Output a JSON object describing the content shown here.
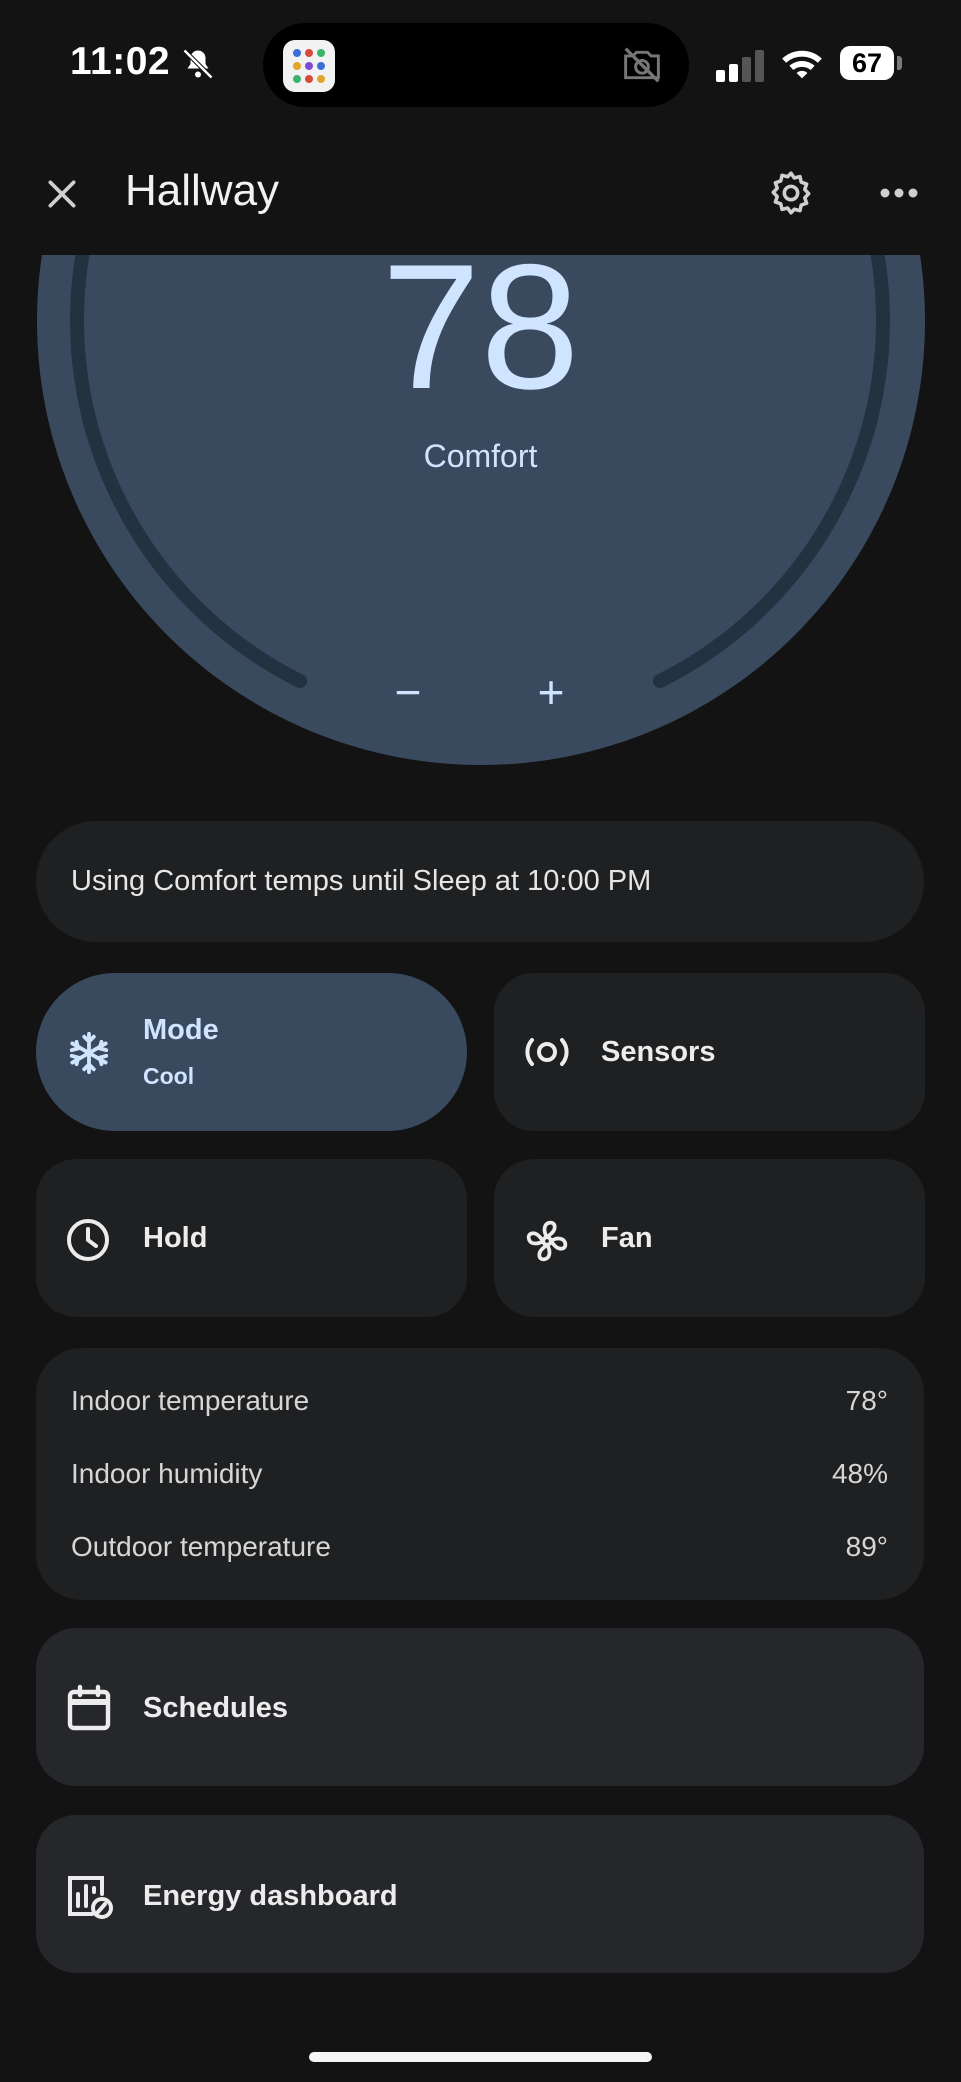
{
  "status_bar": {
    "time": "11:02",
    "battery": "67"
  },
  "header": {
    "title": "Hallway",
    "close_icon": "close-icon",
    "settings_icon": "gear-icon",
    "more_icon": "more-horizontal-icon"
  },
  "dial": {
    "temperature": "78",
    "preset": "Comfort",
    "decrease_label": "−",
    "increase_label": "+"
  },
  "banner": {
    "text": "Using Comfort temps until Sleep at 10:00 PM"
  },
  "tiles": {
    "mode": {
      "label": "Mode",
      "value": "Cool",
      "icon": "snowflake-icon"
    },
    "sensors": {
      "label": "Sensors",
      "icon": "sensor-icon"
    },
    "hold": {
      "label": "Hold",
      "icon": "clock-icon"
    },
    "fan": {
      "label": "Fan",
      "icon": "fan-icon"
    }
  },
  "stats": [
    {
      "label": "Indoor temperature",
      "value": "78°"
    },
    {
      "label": "Indoor humidity",
      "value": "48%"
    },
    {
      "label": "Outdoor temperature",
      "value": "89°"
    }
  ],
  "links": {
    "schedules": {
      "label": "Schedules",
      "icon": "calendar-icon"
    },
    "energy": {
      "label": "Energy dashboard",
      "icon": "energy-dashboard-icon"
    }
  },
  "colors": {
    "background": "#131314",
    "dial": "#3a4a5e",
    "accent_text": "#cfe4ff",
    "card": "#1f2022",
    "active_tile": "#3a4a5e"
  }
}
